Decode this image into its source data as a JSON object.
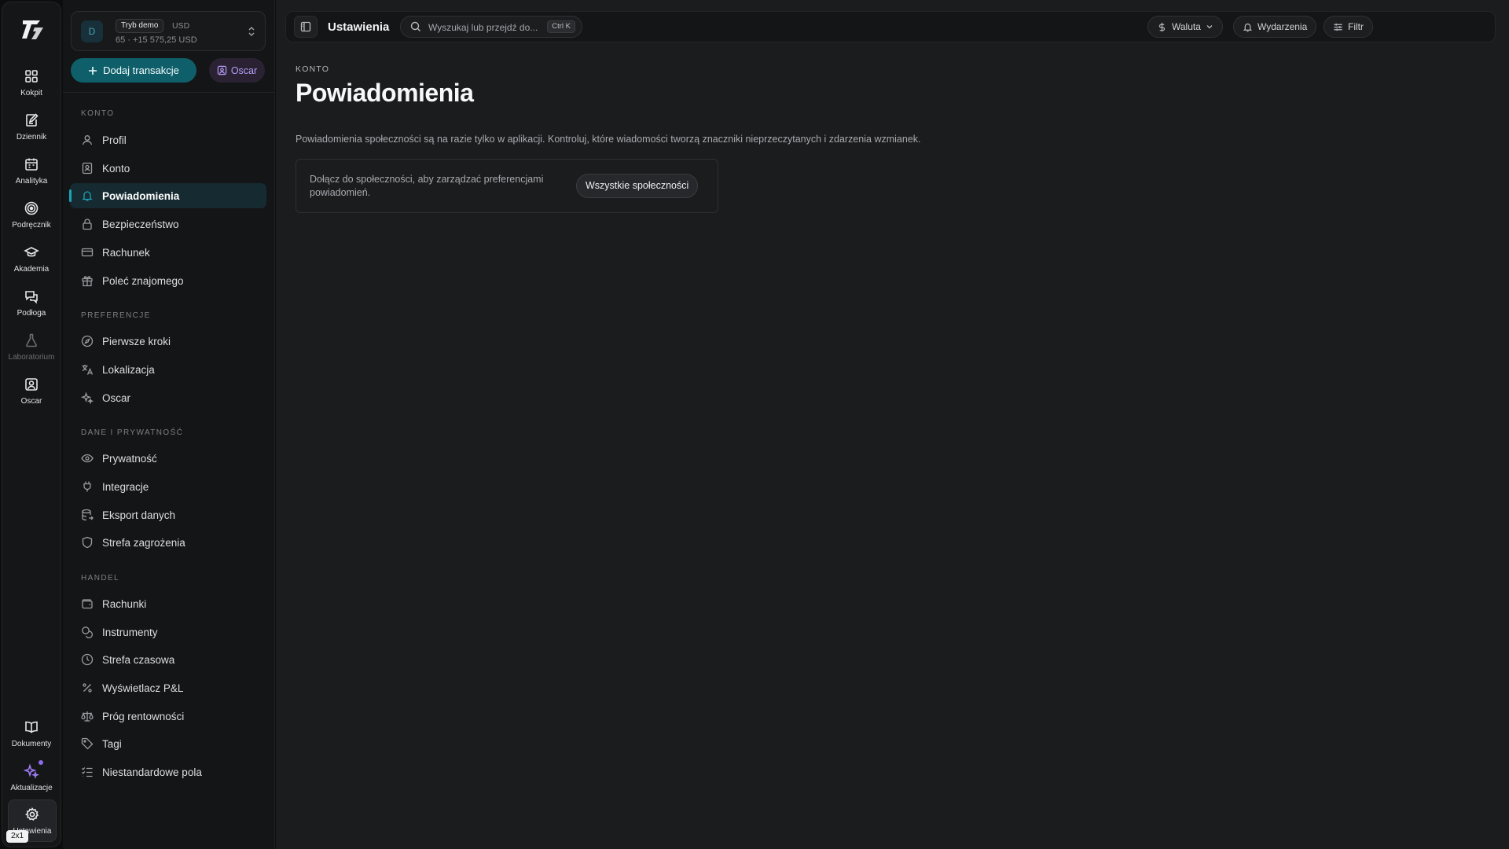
{
  "rail": {
    "items": [
      {
        "label": "Kokpit",
        "icon": "dashboard-icon"
      },
      {
        "label": "Dziennik",
        "icon": "journal-icon"
      },
      {
        "label": "Analityka",
        "icon": "calendar-icon"
      },
      {
        "label": "Podręcznik",
        "icon": "target-icon"
      },
      {
        "label": "Akademia",
        "icon": "graduation-cap-icon"
      },
      {
        "label": "Podłoga",
        "icon": "chat-bubbles-icon"
      },
      {
        "label": "Laboratorium",
        "icon": "flask-icon"
      },
      {
        "label": "Oscar",
        "icon": "oscar-portrait-icon"
      }
    ],
    "bottom": [
      {
        "label": "Dokumenty",
        "icon": "book-icon"
      },
      {
        "label": "Aktualizacje",
        "icon": "sparkles-icon"
      },
      {
        "label": "Ustawienia",
        "icon": "gear-icon"
      }
    ],
    "badge": "2x1"
  },
  "account": {
    "avatar": "D",
    "mode_badge": "Tryb demo",
    "currency": "USD",
    "balance": "65 · +15 575,25 USD"
  },
  "actions": {
    "add_transaction": "Dodaj transakcje",
    "oscar": "Oscar"
  },
  "sidebar": {
    "sections": [
      {
        "title": "KONTO",
        "items": [
          "Profil",
          "Konto",
          "Powiadomienia",
          "Bezpieczeństwo",
          "Rachunek",
          "Poleć znajomego"
        ]
      },
      {
        "title": "PREFERENCJE",
        "items": [
          "Pierwsze kroki",
          "Lokalizacja",
          "Oscar"
        ]
      },
      {
        "title": "DANE I PRYWATNOŚĆ",
        "items": [
          "Prywatność",
          "Integracje",
          "Eksport danych",
          "Strefa zagrożenia"
        ]
      },
      {
        "title": "HANDEL",
        "items": [
          "Rachunki",
          "Instrumenty",
          "Strefa czasowa",
          "Wyświetlacz P&L",
          "Próg rentowności",
          "Tagi",
          "Niestandardowe pola"
        ]
      }
    ],
    "active": "Powiadomienia"
  },
  "topbar": {
    "title": "Ustawienia",
    "search_placeholder": "Wyszukaj lub przejdź do...",
    "search_shortcut": "Ctrl K",
    "currency_label": "Waluta",
    "events_label": "Wydarzenia",
    "filter_label": "Filtr"
  },
  "content": {
    "breadcrumb": "KONTO",
    "title": "Powiadomienia",
    "description": "Powiadomienia społeczności są na razie tylko w aplikacji. Kontroluj, które wiadomości tworzą znaczniki nieprzeczytanych i zdarzenia wzmianek.",
    "card_text": "Dołącz do społeczności, aby zarządzać preferencjami powiadomień.",
    "card_button": "Wszystkie społeczności"
  },
  "colors": {
    "accent_teal": "#0f5f6a",
    "active_nav_bg": "#162a31",
    "oscar_purple": "#b69cf5"
  }
}
